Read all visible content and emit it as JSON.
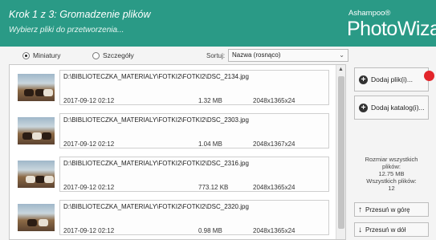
{
  "header": {
    "step_title": "Krok 1 z 3: Gromadzenie plików",
    "step_subtitle": "Wybierz pliki do przetworzenia...",
    "brand_small": "Ashampoo®",
    "brand_big": "PhotoWizard"
  },
  "view": {
    "option1": "Miniatury",
    "option2": "Szczegóły",
    "selected": "Miniatury",
    "sort_label": "Sortuj:",
    "sort_value": "Nazwa (rosnąco)"
  },
  "files": [
    {
      "path": "D:\\BIBLIOTECZKA_MATERIALY\\FOTKI2\\FOTKI2\\DSC_2134.jpg",
      "date": "2017-09-12 02:12",
      "size": "1.32 MB",
      "dims": "2048x1365x24"
    },
    {
      "path": "D:\\BIBLIOTECZKA_MATERIALY\\FOTKI2\\FOTKI2\\DSC_2303.jpg",
      "date": "2017-09-12 02:12",
      "size": "1.04 MB",
      "dims": "2048x1367x24"
    },
    {
      "path": "D:\\BIBLIOTECZKA_MATERIALY\\FOTKI2\\FOTKI2\\DSC_2316.jpg",
      "date": "2017-09-12 02:12",
      "size": "773.12 KB",
      "dims": "2048x1365x24"
    },
    {
      "path": "D:\\BIBLIOTECZKA_MATERIALY\\FOTKI2\\FOTKI2\\DSC_2320.jpg",
      "date": "2017-09-12 02:12",
      "size": "0.98 MB",
      "dims": "2048x1365x24"
    }
  ],
  "actions": {
    "add_files": "Dodaj plik(i)...",
    "add_folder": "Dodaj katalog(i)...",
    "move_up": "Przesuń w górę",
    "move_down": "Przesuń w dół"
  },
  "stats": {
    "size_label": "Rozmiar wszystkich",
    "size_label2": "plików:",
    "size_value": "12.75 MB",
    "count_label": "Wszystkich plików:",
    "count_value": "12"
  },
  "colors": {
    "header": "#2a9a86",
    "marker": "#e3262b"
  }
}
